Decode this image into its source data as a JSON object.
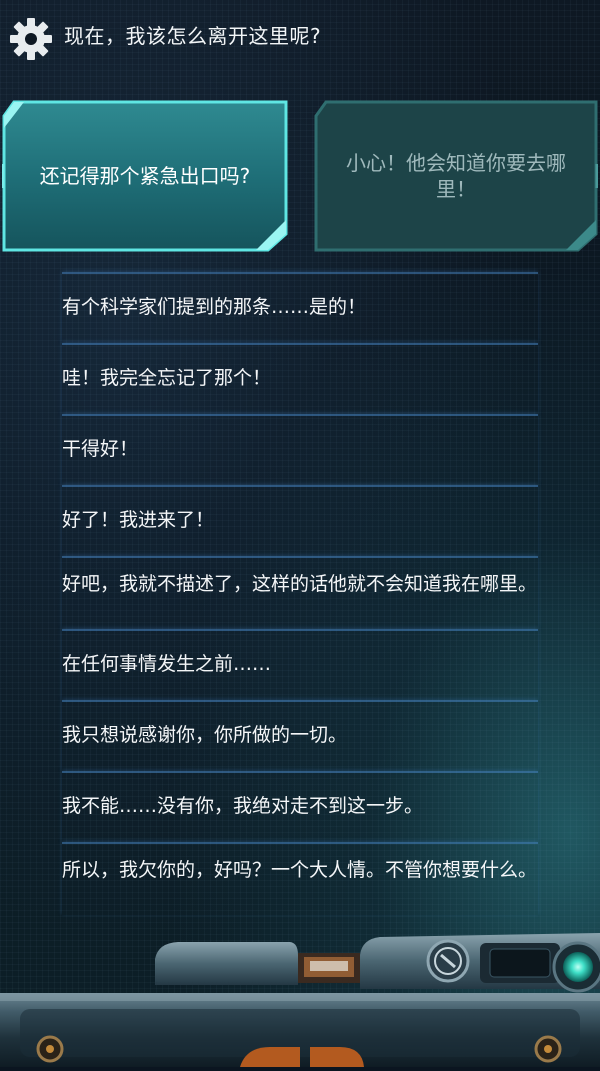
{
  "prompt": "现在，我该怎么离开这里呢?",
  "choices": [
    {
      "label": "还记得那个紧急出口吗?"
    },
    {
      "label": "小心！他会知道你要去哪里！"
    }
  ],
  "log": [
    {
      "text": "有个科学家们提到的那条……是的！"
    },
    {
      "text": "哇！我完全忘记了那个！"
    },
    {
      "text": "干得好！"
    },
    {
      "text": "好了！我进来了！"
    },
    {
      "text": "好吧，我就不描述了，这样的话他就不会知道我在哪里。"
    },
    {
      "text": "在任何事情发生之前……"
    },
    {
      "text": "我只想说感谢你，你所做的一切。"
    },
    {
      "text": "我不能……没有你，我绝对走不到这一步。"
    },
    {
      "text": "所以，我欠你的，好吗？一个大人情。不管你想要什么。"
    }
  ],
  "colors": {
    "accent": "#3fd2cf",
    "choice_active_fill": "#1f6f78",
    "choice_inactive_fill": "#1d4448",
    "divider": "#3a6fa8",
    "background": "#0b1520"
  },
  "icons": {
    "settings": "gear-icon",
    "device_button": "circular-arrow-button-icon",
    "status_light": "green-indicator-light-icon"
  }
}
